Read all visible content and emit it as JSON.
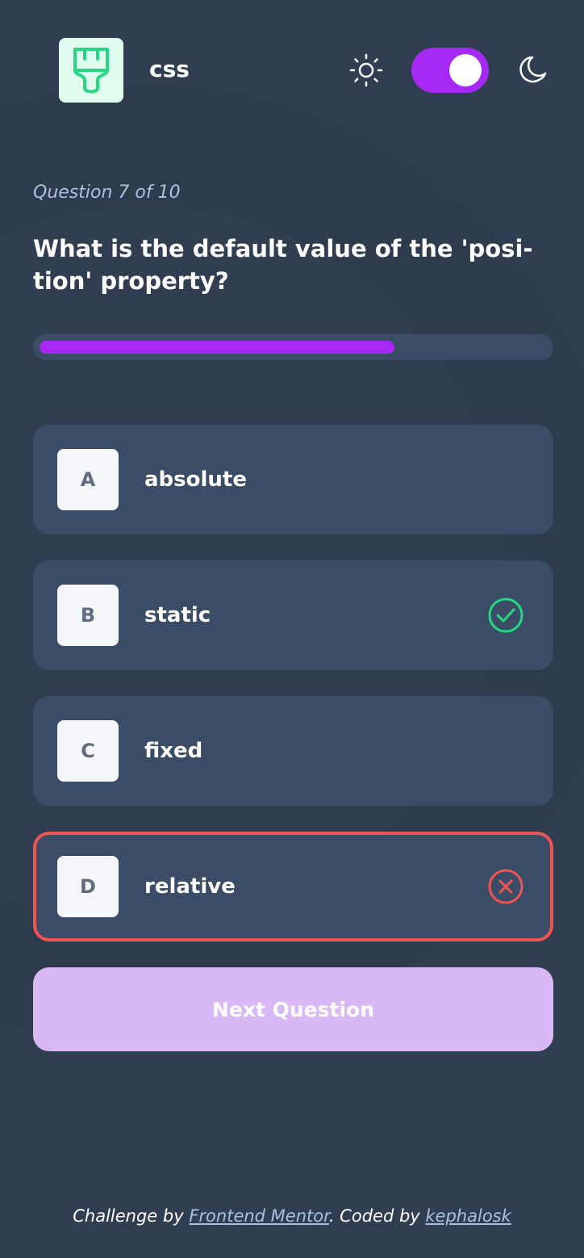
{
  "colors": {
    "background": "#313e51",
    "surface": "#3b4d66",
    "accent": "#a729f5",
    "correct": "#26d782",
    "incorrect": "#ee5454",
    "button_disabled": "#d9b8f6",
    "muted_text": "#abc1e1"
  },
  "header": {
    "subject_icon": "paintbrush-icon",
    "subject_name": "css",
    "theme_toggle": {
      "left_icon": "sun-icon",
      "right_icon": "moon-icon",
      "dark_mode_on": true
    }
  },
  "quiz": {
    "counter": "Question 7 of 10",
    "question": "What is the default value of the 'posi-tion' property?",
    "progress_fraction": 0.7,
    "options": [
      {
        "letter": "A",
        "text": "absolute",
        "state": "default"
      },
      {
        "letter": "B",
        "text": "static",
        "state": "correct",
        "icon": "check-circle-icon"
      },
      {
        "letter": "C",
        "text": "fixed",
        "state": "default"
      },
      {
        "letter": "D",
        "text": "relative",
        "state": "wrong",
        "icon": "x-circle-icon"
      }
    ],
    "next_button_label": "Next Question"
  },
  "footer": {
    "prefix": "Challenge by ",
    "link1": "Frontend Mentor",
    "middle": ". Coded by ",
    "link2": "kephalosk"
  }
}
